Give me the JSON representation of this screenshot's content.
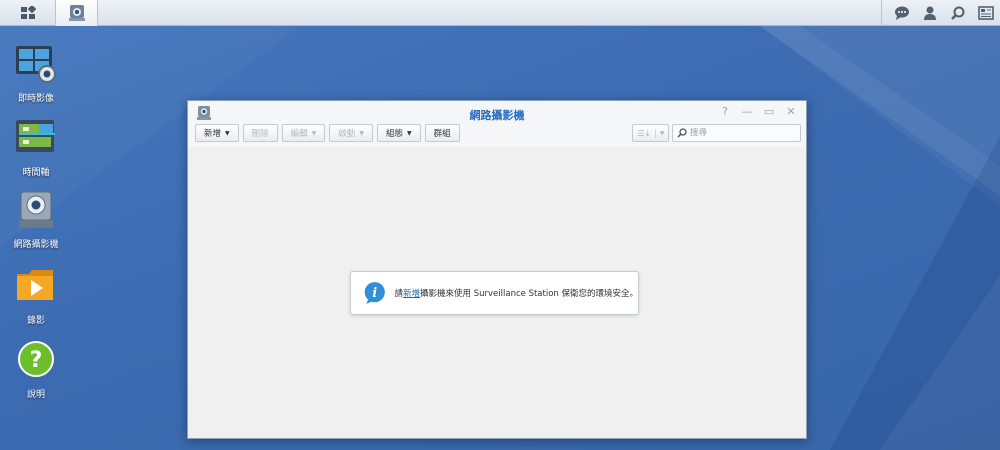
{
  "taskbar": {
    "main_menu_icon": "grid-icon",
    "open_app_icon": "camera-icon",
    "right_icons": [
      "chat-icon",
      "user-icon",
      "search-icon",
      "widgets-icon"
    ]
  },
  "desktop": {
    "icons": [
      {
        "label": "即時影像",
        "icon": "live-view-icon"
      },
      {
        "label": "時間軸",
        "icon": "timeline-icon"
      },
      {
        "label": "網路攝影機",
        "icon": "ip-camera-icon"
      },
      {
        "label": "錄影",
        "icon": "recording-icon"
      },
      {
        "label": "說明",
        "icon": "help-icon"
      }
    ]
  },
  "window": {
    "title": "網路攝影機",
    "controls": {
      "help": "?",
      "minimize": "—",
      "maximize": "▭",
      "close": "✕"
    },
    "toolbar": {
      "add": "新增",
      "delete": "刪除",
      "edit": "編輯",
      "enable": "啟動",
      "configure": "組態",
      "group": "群組"
    },
    "search": {
      "placeholder": "搜尋"
    },
    "notice": {
      "prefix": "請",
      "link": "新增",
      "suffix": "攝影機來使用 Surveillance Station 保衛您的環境安全。"
    }
  },
  "colors": {
    "desktop_bg": "#3f6fb5",
    "title": "#2a6ec0",
    "link": "#1d64b8"
  }
}
